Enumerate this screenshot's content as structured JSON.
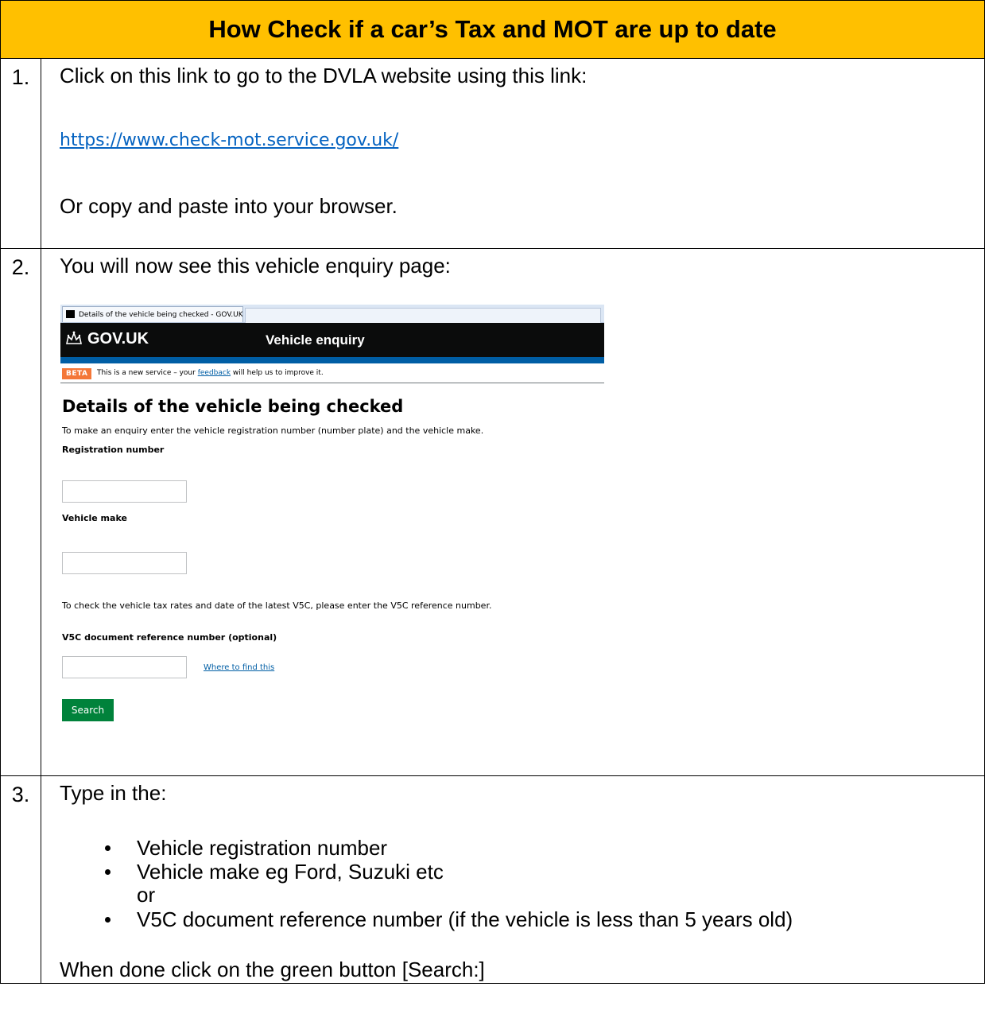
{
  "title": "How Check if a car’s Tax and MOT are up to date",
  "steps": [
    {
      "number": "1.",
      "intro": "Click on this link to go to the DVLA website using this link:",
      "link": "https://www.check-mot.service.gov.uk/",
      "outro": "Or copy and paste into your browser."
    },
    {
      "number": "2.",
      "intro": "You will now see this vehicle enquiry page:"
    },
    {
      "number": "3.",
      "intro": "Type in the:",
      "bullets": [
        "Vehicle registration number",
        "Vehicle make eg Ford, Suzuki etc",
        "V5C document reference number (if the vehicle is less than 5 years old)"
      ],
      "or_text": "or",
      "outro": "When done click on the green button [Search:]"
    }
  ],
  "screenshot": {
    "browser_tab_title": "Details of the vehicle being checked - GOV.UK",
    "logo": "GOV.UK",
    "service_name": "Vehicle enquiry",
    "beta_tag": "BETA",
    "beta_text_before": "This is a new service – your ",
    "beta_link": "feedback",
    "beta_text_after": " will help us to improve it.",
    "heading": "Details of the vehicle being checked",
    "intro": "To make an enquiry enter the vehicle registration number (number plate) and the vehicle make.",
    "registration_label": "Registration number",
    "registration_value": "",
    "make_label": "Vehicle make",
    "make_value": "",
    "v5c_hint": "To check the vehicle tax rates and date of the latest V5C, please enter the V5C reference number.",
    "v5c_label": "V5C document reference number (optional)",
    "v5c_value": "",
    "where_link": "Where to find this",
    "search_button": "Search"
  }
}
